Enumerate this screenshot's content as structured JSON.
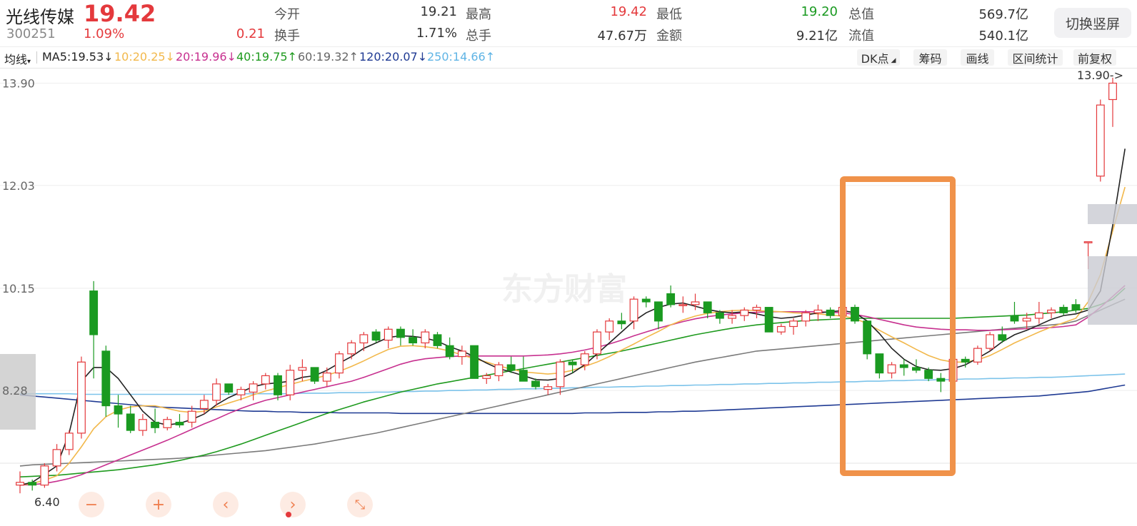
{
  "stock": {
    "name": "光线传媒",
    "code": "300251",
    "price": "19.42",
    "change_pct": "1.09%",
    "change_abs": "0.21"
  },
  "quote": {
    "open_label": "今开",
    "open": "19.21",
    "high_label": "最高",
    "high": "19.42",
    "low_label": "最低",
    "low": "19.20",
    "total_mv_label": "总值",
    "total_mv": "569.7亿",
    "turnover_label": "换手",
    "turnover": "1.71%",
    "volume_label": "总手",
    "volume": "47.67万",
    "amount_label": "金额",
    "amount": "9.21亿",
    "float_mv_label": "流值",
    "float_mv": "540.1亿"
  },
  "switch_button": "切换竖屏",
  "toolbar": {
    "ma_type": "均线",
    "ma5": "MA5:19.53↓",
    "ma10": "10:20.25↓",
    "ma20": "20:19.96↓",
    "ma40": "40:19.75↑",
    "ma60": "60:19.32↑",
    "ma120": "120:20.07↓",
    "ma250": "250:14.66↑",
    "dk": "DK点",
    "chip": "筹码",
    "draw": "画线",
    "range": "区间统计",
    "adjust": "前复权"
  },
  "colors": {
    "up": "#e4393c",
    "down": "#1a9a21",
    "ma5": "#222222",
    "ma10": "#f2b84b",
    "ma20": "#c7308f",
    "ma40": "#1e9a1e",
    "ma60": "#7a7a7a",
    "ma120": "#1f3a93",
    "ma250": "#7cc3ea",
    "highlight": "#f0924a"
  },
  "watermark": "东方财富",
  "chart_data": {
    "type": "candlestick",
    "yticks": [
      "13.90",
      "12.03",
      "10.15",
      "8.28"
    ],
    "ylim": [
      6.35,
      14.05
    ],
    "max_marker": "13.90->",
    "min_marker": "6.40",
    "candles": [
      [
        6.55,
        6.8,
        6.4,
        6.6
      ],
      [
        6.6,
        6.65,
        6.45,
        6.55
      ],
      [
        6.55,
        6.95,
        6.5,
        6.9
      ],
      [
        6.9,
        7.3,
        6.8,
        7.2
      ],
      [
        7.2,
        7.55,
        7.1,
        7.5
      ],
      [
        7.5,
        8.9,
        7.4,
        8.8
      ],
      [
        10.1,
        10.28,
        8.5,
        9.3
      ],
      [
        9.0,
        9.1,
        7.8,
        8.0
      ],
      [
        8.0,
        8.2,
        7.6,
        7.85
      ],
      [
        7.85,
        8.0,
        7.5,
        7.55
      ],
      [
        7.55,
        7.85,
        7.45,
        7.75
      ],
      [
        7.7,
        7.95,
        7.5,
        7.6
      ],
      [
        7.6,
        7.8,
        7.55,
        7.75
      ],
      [
        7.7,
        7.85,
        7.6,
        7.65
      ],
      [
        7.7,
        8.0,
        7.6,
        7.9
      ],
      [
        7.95,
        8.2,
        7.85,
        8.1
      ],
      [
        8.1,
        8.5,
        8.0,
        8.4
      ],
      [
        8.4,
        8.3,
        8.2,
        8.25
      ],
      [
        8.2,
        8.35,
        8.1,
        8.3
      ],
      [
        8.25,
        8.45,
        8.1,
        8.4
      ],
      [
        8.4,
        8.6,
        8.3,
        8.55
      ],
      [
        8.55,
        8.6,
        8.1,
        8.2
      ],
      [
        8.2,
        8.75,
        8.1,
        8.65
      ],
      [
        8.65,
        8.85,
        8.45,
        8.7
      ],
      [
        8.7,
        8.65,
        8.4,
        8.45
      ],
      [
        8.45,
        8.7,
        8.35,
        8.6
      ],
      [
        8.6,
        9.0,
        8.5,
        8.95
      ],
      [
        8.95,
        9.2,
        8.85,
        9.15
      ],
      [
        9.15,
        9.35,
        9.0,
        9.3
      ],
      [
        9.35,
        9.4,
        9.15,
        9.2
      ],
      [
        9.2,
        9.45,
        9.05,
        9.4
      ],
      [
        9.4,
        9.45,
        9.1,
        9.25
      ],
      [
        9.25,
        9.4,
        9.1,
        9.15
      ],
      [
        9.15,
        9.4,
        9.05,
        9.35
      ],
      [
        9.3,
        9.35,
        9.05,
        9.1
      ],
      [
        9.1,
        9.25,
        8.85,
        8.9
      ],
      [
        8.9,
        9.1,
        8.75,
        9.0
      ],
      [
        9.1,
        9.05,
        8.5,
        8.5
      ],
      [
        8.5,
        8.6,
        8.4,
        8.55
      ],
      [
        8.55,
        8.8,
        8.45,
        8.75
      ],
      [
        8.75,
        8.9,
        8.6,
        8.65
      ],
      [
        8.65,
        8.9,
        8.55,
        8.45
      ],
      [
        8.45,
        8.5,
        8.3,
        8.35
      ],
      [
        8.3,
        8.4,
        8.2,
        8.35
      ],
      [
        8.35,
        8.85,
        8.2,
        8.8
      ],
      [
        8.8,
        8.85,
        8.6,
        8.75
      ],
      [
        8.75,
        9.0,
        8.65,
        8.95
      ],
      [
        8.95,
        9.4,
        8.85,
        9.35
      ],
      [
        9.35,
        9.6,
        9.2,
        9.55
      ],
      [
        9.55,
        9.7,
        9.4,
        9.5
      ],
      [
        9.55,
        10.0,
        9.4,
        9.95
      ],
      [
        9.95,
        10.0,
        9.8,
        9.9
      ],
      [
        9.9,
        9.8,
        9.4,
        9.55
      ],
      [
        10.05,
        10.2,
        9.8,
        9.85
      ],
      [
        9.85,
        10.0,
        9.7,
        9.85
      ],
      [
        9.85,
        10.05,
        9.75,
        9.9
      ],
      [
        9.9,
        9.85,
        9.6,
        9.7
      ],
      [
        9.7,
        9.75,
        9.5,
        9.6
      ],
      [
        9.6,
        9.75,
        9.5,
        9.65
      ],
      [
        9.65,
        9.8,
        9.55,
        9.75
      ],
      [
        9.75,
        9.85,
        9.6,
        9.8
      ],
      [
        9.8,
        9.8,
        9.35,
        9.35
      ],
      [
        9.35,
        9.5,
        9.3,
        9.45
      ],
      [
        9.45,
        9.6,
        9.3,
        9.55
      ],
      [
        9.55,
        9.75,
        9.45,
        9.7
      ],
      [
        9.7,
        9.85,
        9.55,
        9.75
      ],
      [
        9.75,
        9.8,
        9.6,
        9.65
      ],
      [
        9.65,
        9.9,
        9.55,
        9.8
      ],
      [
        9.8,
        9.85,
        9.5,
        9.55
      ],
      [
        9.55,
        9.5,
        8.85,
        8.95
      ],
      [
        8.95,
        8.9,
        8.5,
        8.6
      ],
      [
        8.6,
        8.8,
        8.5,
        8.75
      ],
      [
        8.75,
        8.85,
        8.55,
        8.7
      ],
      [
        8.7,
        8.85,
        8.6,
        8.65
      ],
      [
        8.65,
        8.7,
        8.45,
        8.5
      ],
      [
        8.5,
        8.6,
        8.25,
        8.45
      ],
      [
        8.45,
        8.9,
        8.4,
        8.85
      ],
      [
        8.85,
        8.9,
        8.7,
        8.8
      ],
      [
        8.8,
        9.1,
        8.75,
        9.05
      ],
      [
        9.05,
        9.35,
        9.0,
        9.3
      ],
      [
        9.3,
        9.45,
        9.15,
        9.2
      ],
      [
        9.65,
        9.9,
        9.5,
        9.55
      ],
      [
        9.55,
        9.7,
        9.4,
        9.6
      ],
      [
        9.6,
        9.9,
        9.5,
        9.7
      ],
      [
        9.7,
        9.8,
        9.6,
        9.75
      ],
      [
        9.8,
        9.85,
        9.65,
        9.7
      ],
      [
        9.85,
        9.95,
        9.7,
        9.75
      ],
      [
        11.0,
        11.0,
        10.5,
        11.0
      ],
      [
        12.2,
        13.6,
        12.1,
        13.5
      ],
      [
        13.6,
        14.0,
        13.1,
        13.9
      ]
    ],
    "ma5": [
      6.55,
      6.6,
      6.75,
      6.9,
      7.5,
      8.45,
      8.7,
      8.7,
      8.5,
      8.2,
      7.9,
      7.7,
      7.65,
      7.68,
      7.75,
      7.85,
      8.02,
      8.15,
      8.25,
      8.35,
      8.4,
      8.42,
      8.45,
      8.52,
      8.55,
      8.65,
      8.78,
      8.9,
      9.05,
      9.15,
      9.25,
      9.28,
      9.27,
      9.24,
      9.18,
      9.08,
      9.0,
      8.9,
      8.78,
      8.68,
      8.62,
      8.55,
      8.48,
      8.47,
      8.5,
      8.6,
      8.75,
      8.95,
      9.15,
      9.35,
      9.55,
      9.7,
      9.8,
      9.86,
      9.88,
      9.82,
      9.76,
      9.72,
      9.7,
      9.72,
      9.68,
      9.63,
      9.6,
      9.62,
      9.66,
      9.7,
      9.72,
      9.74,
      9.7,
      9.55,
      9.32,
      9.05,
      8.85,
      8.72,
      8.66,
      8.65,
      8.68,
      8.75,
      8.87,
      9.0,
      9.17,
      9.3,
      9.38,
      9.48,
      9.58,
      9.65,
      9.68,
      9.75,
      10.1,
      11.3,
      12.7
    ],
    "ma10": [
      6.55,
      6.58,
      6.64,
      6.72,
      6.95,
      7.25,
      7.58,
      7.8,
      7.92,
      7.98,
      8.0,
      8.0,
      7.95,
      7.9,
      7.88,
      7.9,
      7.98,
      8.05,
      8.12,
      8.2,
      8.27,
      8.33,
      8.39,
      8.45,
      8.5,
      8.56,
      8.63,
      8.72,
      8.82,
      8.93,
      9.03,
      9.09,
      9.1,
      9.08,
      9.05,
      9.0,
      8.93,
      8.86,
      8.8,
      8.73,
      8.67,
      8.62,
      8.6,
      8.58,
      8.6,
      8.65,
      8.72,
      8.8,
      8.9,
      9.02,
      9.13,
      9.25,
      9.36,
      9.48,
      9.57,
      9.64,
      9.69,
      9.72,
      9.74,
      9.75,
      9.74,
      9.73,
      9.72,
      9.7,
      9.69,
      9.68,
      9.66,
      9.64,
      9.6,
      9.5,
      9.38,
      9.26,
      9.15,
      9.03,
      8.92,
      8.84,
      8.8,
      8.8,
      8.84,
      8.92,
      9.03,
      9.15,
      9.25,
      9.35,
      9.44,
      9.52,
      9.6,
      9.9,
      10.4,
      11.2,
      12.0
    ],
    "ma20": [
      6.55,
      6.56,
      6.58,
      6.62,
      6.67,
      6.74,
      6.83,
      6.92,
      7.01,
      7.1,
      7.19,
      7.28,
      7.37,
      7.47,
      7.57,
      7.67,
      7.76,
      7.86,
      7.95,
      8.03,
      8.1,
      8.15,
      8.2,
      8.25,
      8.3,
      8.35,
      8.4,
      8.45,
      8.52,
      8.6,
      8.68,
      8.76,
      8.82,
      8.86,
      8.88,
      8.9,
      8.91,
      8.91,
      8.91,
      8.91,
      8.91,
      8.91,
      8.92,
      8.93,
      8.95,
      8.98,
      9.02,
      9.07,
      9.13,
      9.2,
      9.28,
      9.35,
      9.42,
      9.48,
      9.54,
      9.59,
      9.63,
      9.66,
      9.68,
      9.7,
      9.71,
      9.72,
      9.72,
      9.72,
      9.72,
      9.72,
      9.71,
      9.7,
      9.67,
      9.63,
      9.58,
      9.53,
      9.48,
      9.44,
      9.42,
      9.4,
      9.39,
      9.39,
      9.38,
      9.38,
      9.39,
      9.4,
      9.41,
      9.42,
      9.43,
      9.45,
      9.48,
      9.62,
      9.8,
      10.0,
      10.2
    ],
    "ma40": [
      6.7,
      6.71,
      6.72,
      6.73,
      6.75,
      6.77,
      6.79,
      6.81,
      6.83,
      6.86,
      6.89,
      6.92,
      6.96,
      7.0,
      7.05,
      7.1,
      7.16,
      7.23,
      7.3,
      7.38,
      7.46,
      7.54,
      7.62,
      7.7,
      7.78,
      7.86,
      7.93,
      8.0,
      8.07,
      8.13,
      8.19,
      8.25,
      8.3,
      8.35,
      8.4,
      8.44,
      8.48,
      8.52,
      8.56,
      8.6,
      8.64,
      8.68,
      8.72,
      8.76,
      8.8,
      8.84,
      8.88,
      8.92,
      8.96,
      9.0,
      9.05,
      9.1,
      9.15,
      9.2,
      9.25,
      9.3,
      9.34,
      9.38,
      9.42,
      9.45,
      9.48,
      9.5,
      9.52,
      9.54,
      9.56,
      9.57,
      9.58,
      9.59,
      9.6,
      9.6,
      9.6,
      9.6,
      9.6,
      9.6,
      9.6,
      9.6,
      9.6,
      9.61,
      9.62,
      9.63,
      9.64,
      9.65,
      9.66,
      9.68,
      9.7,
      9.72,
      9.75,
      9.78,
      9.85,
      9.95,
      10.15
    ],
    "ma60": [
      6.9,
      6.92,
      6.93,
      6.94,
      6.95,
      6.96,
      6.97,
      6.98,
      6.99,
      7.0,
      7.01,
      7.02,
      7.03,
      7.04,
      7.06,
      7.08,
      7.1,
      7.12,
      7.14,
      7.16,
      7.18,
      7.21,
      7.24,
      7.27,
      7.3,
      7.34,
      7.38,
      7.42,
      7.46,
      7.5,
      7.55,
      7.6,
      7.65,
      7.7,
      7.75,
      7.8,
      7.85,
      7.9,
      7.95,
      8.0,
      8.05,
      8.1,
      8.15,
      8.2,
      8.25,
      8.3,
      8.35,
      8.4,
      8.45,
      8.5,
      8.55,
      8.6,
      8.65,
      8.7,
      8.75,
      8.8,
      8.84,
      8.88,
      8.92,
      8.96,
      9.0,
      9.02,
      9.04,
      9.06,
      9.08,
      9.1,
      9.12,
      9.14,
      9.16,
      9.18,
      9.2,
      9.22,
      9.24,
      9.26,
      9.28,
      9.3,
      9.32,
      9.34,
      9.36,
      9.38,
      9.4,
      9.42,
      9.44,
      9.46,
      9.48,
      9.5,
      9.55,
      9.65,
      9.75,
      9.85,
      9.95
    ],
    "ma120": [
      8.2,
      8.18,
      8.16,
      8.14,
      8.12,
      8.1,
      8.08,
      8.06,
      8.04,
      8.02,
      8.0,
      7.98,
      7.97,
      7.96,
      7.95,
      7.94,
      7.93,
      7.92,
      7.91,
      7.9,
      7.9,
      7.89,
      7.89,
      7.88,
      7.88,
      7.88,
      7.87,
      7.87,
      7.87,
      7.87,
      7.87,
      7.86,
      7.86,
      7.86,
      7.86,
      7.86,
      7.86,
      7.86,
      7.86,
      7.86,
      7.86,
      7.86,
      7.86,
      7.86,
      7.86,
      7.86,
      7.87,
      7.87,
      7.87,
      7.88,
      7.88,
      7.88,
      7.89,
      7.89,
      7.9,
      7.9,
      7.91,
      7.92,
      7.93,
      7.94,
      7.95,
      7.96,
      7.97,
      7.98,
      7.99,
      8.0,
      8.01,
      8.02,
      8.03,
      8.04,
      8.05,
      8.06,
      8.07,
      8.08,
      8.09,
      8.1,
      8.11,
      8.12,
      8.13,
      8.14,
      8.15,
      8.16,
      8.17,
      8.18,
      8.2,
      8.22,
      8.24,
      8.26,
      8.3,
      8.34,
      8.38
    ],
    "ma250": [
      8.22,
      8.22,
      8.22,
      8.22,
      8.22,
      8.21,
      8.21,
      8.21,
      8.21,
      8.21,
      8.21,
      8.21,
      8.21,
      8.21,
      8.21,
      8.21,
      8.21,
      8.21,
      8.22,
      8.22,
      8.22,
      8.22,
      8.22,
      8.23,
      8.23,
      8.23,
      8.24,
      8.24,
      8.24,
      8.25,
      8.25,
      8.26,
      8.26,
      8.27,
      8.27,
      8.28,
      8.28,
      8.29,
      8.29,
      8.3,
      8.3,
      8.31,
      8.31,
      8.32,
      8.32,
      8.33,
      8.33,
      8.34,
      8.34,
      8.35,
      8.35,
      8.36,
      8.36,
      8.37,
      8.37,
      8.38,
      8.38,
      8.39,
      8.39,
      8.4,
      8.4,
      8.41,
      8.41,
      8.42,
      8.42,
      8.43,
      8.43,
      8.44,
      8.44,
      8.45,
      8.45,
      8.46,
      8.46,
      8.47,
      8.47,
      8.48,
      8.48,
      8.49,
      8.49,
      8.5,
      8.5,
      8.51,
      8.51,
      8.52,
      8.52,
      8.53,
      8.54,
      8.55,
      8.56,
      8.57,
      8.58
    ]
  }
}
